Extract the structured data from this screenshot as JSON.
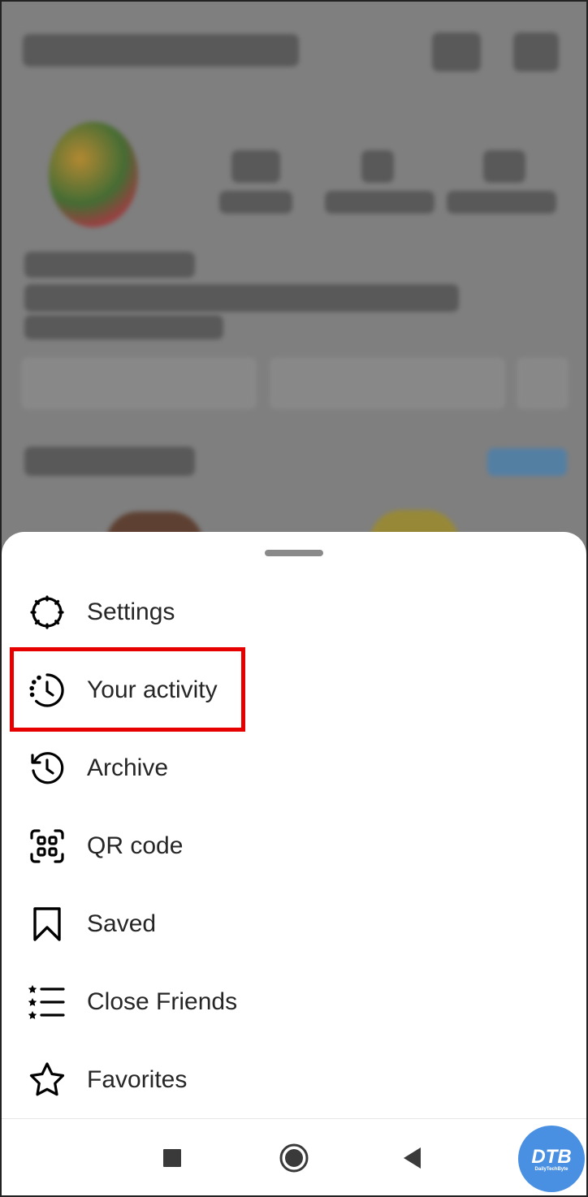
{
  "menu": {
    "items": [
      {
        "label": "Settings",
        "icon": "settings-icon"
      },
      {
        "label": "Your activity",
        "icon": "activity-icon"
      },
      {
        "label": "Archive",
        "icon": "archive-icon"
      },
      {
        "label": "QR code",
        "icon": "qr-code-icon"
      },
      {
        "label": "Saved",
        "icon": "bookmark-icon"
      },
      {
        "label": "Close Friends",
        "icon": "close-friends-icon"
      },
      {
        "label": "Favorites",
        "icon": "star-icon"
      }
    ]
  },
  "watermark": {
    "text": "DTB",
    "subtext": "DailyTechByte"
  },
  "colors": {
    "highlight": "#e60000",
    "watermark": "#4a90e2",
    "overlay": "#7f7f7f"
  }
}
